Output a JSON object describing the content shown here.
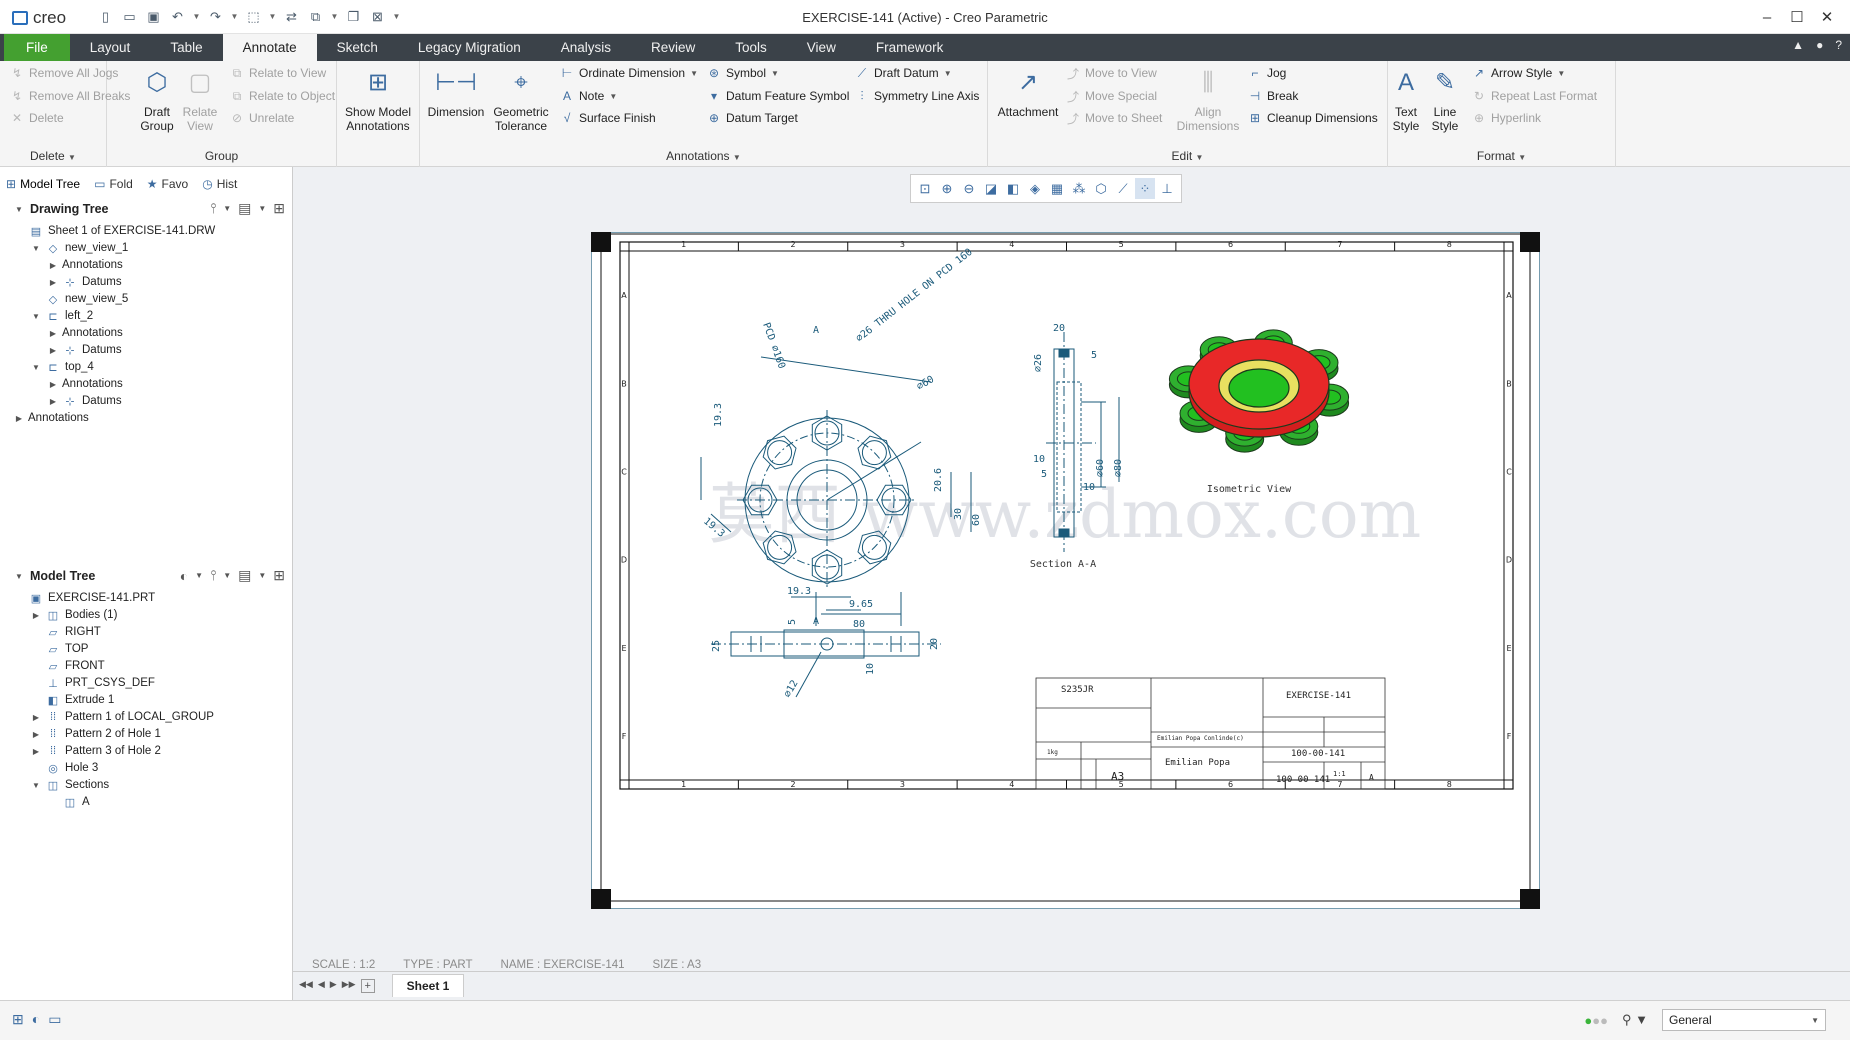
{
  "app": {
    "logo": "creo",
    "window_title": "EXERCISE-141 (Active) - Creo Parametric"
  },
  "tabs": [
    "File",
    "Layout",
    "Table",
    "Annotate",
    "Sketch",
    "Legacy Migration",
    "Analysis",
    "Review",
    "Tools",
    "View",
    "Framework"
  ],
  "active_tab": "Annotate",
  "ribbon": {
    "delete_group": {
      "label": "Delete",
      "items": [
        "Remove All Jogs",
        "Remove All Breaks",
        "Delete"
      ]
    },
    "group_group": {
      "label": "Group",
      "draft_group": "Draft Group",
      "relate_view": "Relate View",
      "items": [
        "Relate to View",
        "Relate to Object",
        "Unrelate"
      ]
    },
    "show_model_annotations": "Show Model Annotations",
    "annotations_group": {
      "label": "Annotations",
      "dimension": "Dimension",
      "geometric_tolerance": "Geometric Tolerance",
      "col1": [
        "Ordinate Dimension",
        "Note",
        "Surface Finish"
      ],
      "col2": [
        "Symbol",
        "Datum Feature Symbol",
        "Datum Target"
      ],
      "col3": [
        "Draft Datum",
        "Symmetry Line Axis"
      ]
    },
    "edit_group": {
      "label": "Edit",
      "attachment": "Attachment",
      "align_dimensions": "Align Dimensions",
      "col1": [
        "Move to View",
        "Move Special",
        "Move to Sheet"
      ],
      "col2": [
        "Jog",
        "Break",
        "Cleanup Dimensions"
      ]
    },
    "format_group": {
      "label": "Format",
      "text_style": "Text Style",
      "line_style": "Line Style",
      "items": [
        "Arrow Style",
        "Repeat Last Format",
        "Hyperlink"
      ]
    }
  },
  "panel": {
    "tabs": [
      "Model Tree",
      "Fold",
      "Favo",
      "Hist"
    ],
    "drawing_tree": {
      "title": "Drawing Tree",
      "rows": [
        {
          "label": "Sheet 1 of EXERCISE-141.DRW",
          "level": 0,
          "tw": "",
          "icon": "▤"
        },
        {
          "label": "new_view_1",
          "level": 1,
          "tw": "▼",
          "icon": "◇"
        },
        {
          "label": "Annotations",
          "level": 2,
          "tw": "▶",
          "icon": ""
        },
        {
          "label": "Datums",
          "level": 2,
          "tw": "▶",
          "icon": "⊹"
        },
        {
          "label": "new_view_5",
          "level": 1,
          "tw": "",
          "icon": "◇"
        },
        {
          "label": "left_2",
          "level": 1,
          "tw": "▼",
          "icon": "⊏"
        },
        {
          "label": "Annotations",
          "level": 2,
          "tw": "▶",
          "icon": ""
        },
        {
          "label": "Datums",
          "level": 2,
          "tw": "▶",
          "icon": "⊹"
        },
        {
          "label": "top_4",
          "level": 1,
          "tw": "▼",
          "icon": "⊏"
        },
        {
          "label": "Annotations",
          "level": 2,
          "tw": "▶",
          "icon": ""
        },
        {
          "label": "Datums",
          "level": 2,
          "tw": "▶",
          "icon": "⊹"
        },
        {
          "label": "Annotations",
          "level": 0,
          "tw": "▶",
          "icon": ""
        }
      ]
    },
    "model_tree": {
      "title": "Model Tree",
      "rows": [
        {
          "label": "EXERCISE-141.PRT",
          "level": 0,
          "tw": "",
          "icon": "▣"
        },
        {
          "label": "Bodies (1)",
          "level": 1,
          "tw": "▶",
          "icon": "◫"
        },
        {
          "label": "RIGHT",
          "level": 1,
          "tw": "",
          "icon": "▱"
        },
        {
          "label": "TOP",
          "level": 1,
          "tw": "",
          "icon": "▱"
        },
        {
          "label": "FRONT",
          "level": 1,
          "tw": "",
          "icon": "▱"
        },
        {
          "label": "PRT_CSYS_DEF",
          "level": 1,
          "tw": "",
          "icon": "⊥"
        },
        {
          "label": "Extrude 1",
          "level": 1,
          "tw": "",
          "icon": "◧"
        },
        {
          "label": "Pattern 1 of LOCAL_GROUP",
          "level": 1,
          "tw": "▶",
          "icon": "⁞⁞"
        },
        {
          "label": "Pattern 2 of Hole 1",
          "level": 1,
          "tw": "▶",
          "icon": "⁞⁞"
        },
        {
          "label": "Pattern 3 of Hole 2",
          "level": 1,
          "tw": "▶",
          "icon": "⁞⁞"
        },
        {
          "label": "Hole 3",
          "level": 1,
          "tw": "",
          "icon": "◎"
        },
        {
          "label": "Sections",
          "level": 1,
          "tw": "▼",
          "icon": "◫"
        },
        {
          "label": "A",
          "level": 2,
          "tw": "",
          "icon": "◫"
        }
      ]
    }
  },
  "drawing": {
    "col_labels": [
      "1",
      "2",
      "3",
      "4",
      "5",
      "6",
      "7",
      "8"
    ],
    "row_labels": [
      "A",
      "B",
      "C",
      "D",
      "E",
      "F"
    ],
    "watermark": "莫西 www.zdmox.com",
    "front_dims": [
      "PCD ⌀160",
      "⌀26 THRU HOLE ON PCD 160",
      "⌀60",
      "19.3",
      "30",
      "20.6",
      "60",
      "19.3",
      "80",
      "A",
      "A"
    ],
    "section_dims": [
      "20",
      "5",
      "⌀26",
      "⌀60",
      "⌀80",
      "10",
      "5",
      "10"
    ],
    "top_dims": [
      "19.3",
      "9.65",
      "5",
      "25",
      "20",
      "⌀12",
      "10"
    ],
    "section_label": "Section A-A",
    "iso_label": "Isometric View",
    "title_block": {
      "material": "S235JR",
      "description": "EXERCISE-141",
      "drawing_number": "100-00-141",
      "drawing_number2": "100-00-141",
      "size": "A3",
      "scale": "1:1",
      "rev": "A",
      "author": "Emilian Popa",
      "author_note": "Emilian Popa Conlinde(c)",
      "weight": "1kg"
    }
  },
  "info": {
    "scale": "SCALE : 1:2",
    "type": "TYPE : PART",
    "name": "NAME : EXERCISE-141",
    "size": "SIZE : A3"
  },
  "sheet_tab": "Sheet 1",
  "status": {
    "filter": "General"
  },
  "colors": {
    "tabbar": "#3b4249",
    "file": "#44a030",
    "drawing_line": "#1a5a7a",
    "iso_red": "#e02020",
    "iso_green": "#22c020",
    "iso_yellow": "#e8e060"
  }
}
